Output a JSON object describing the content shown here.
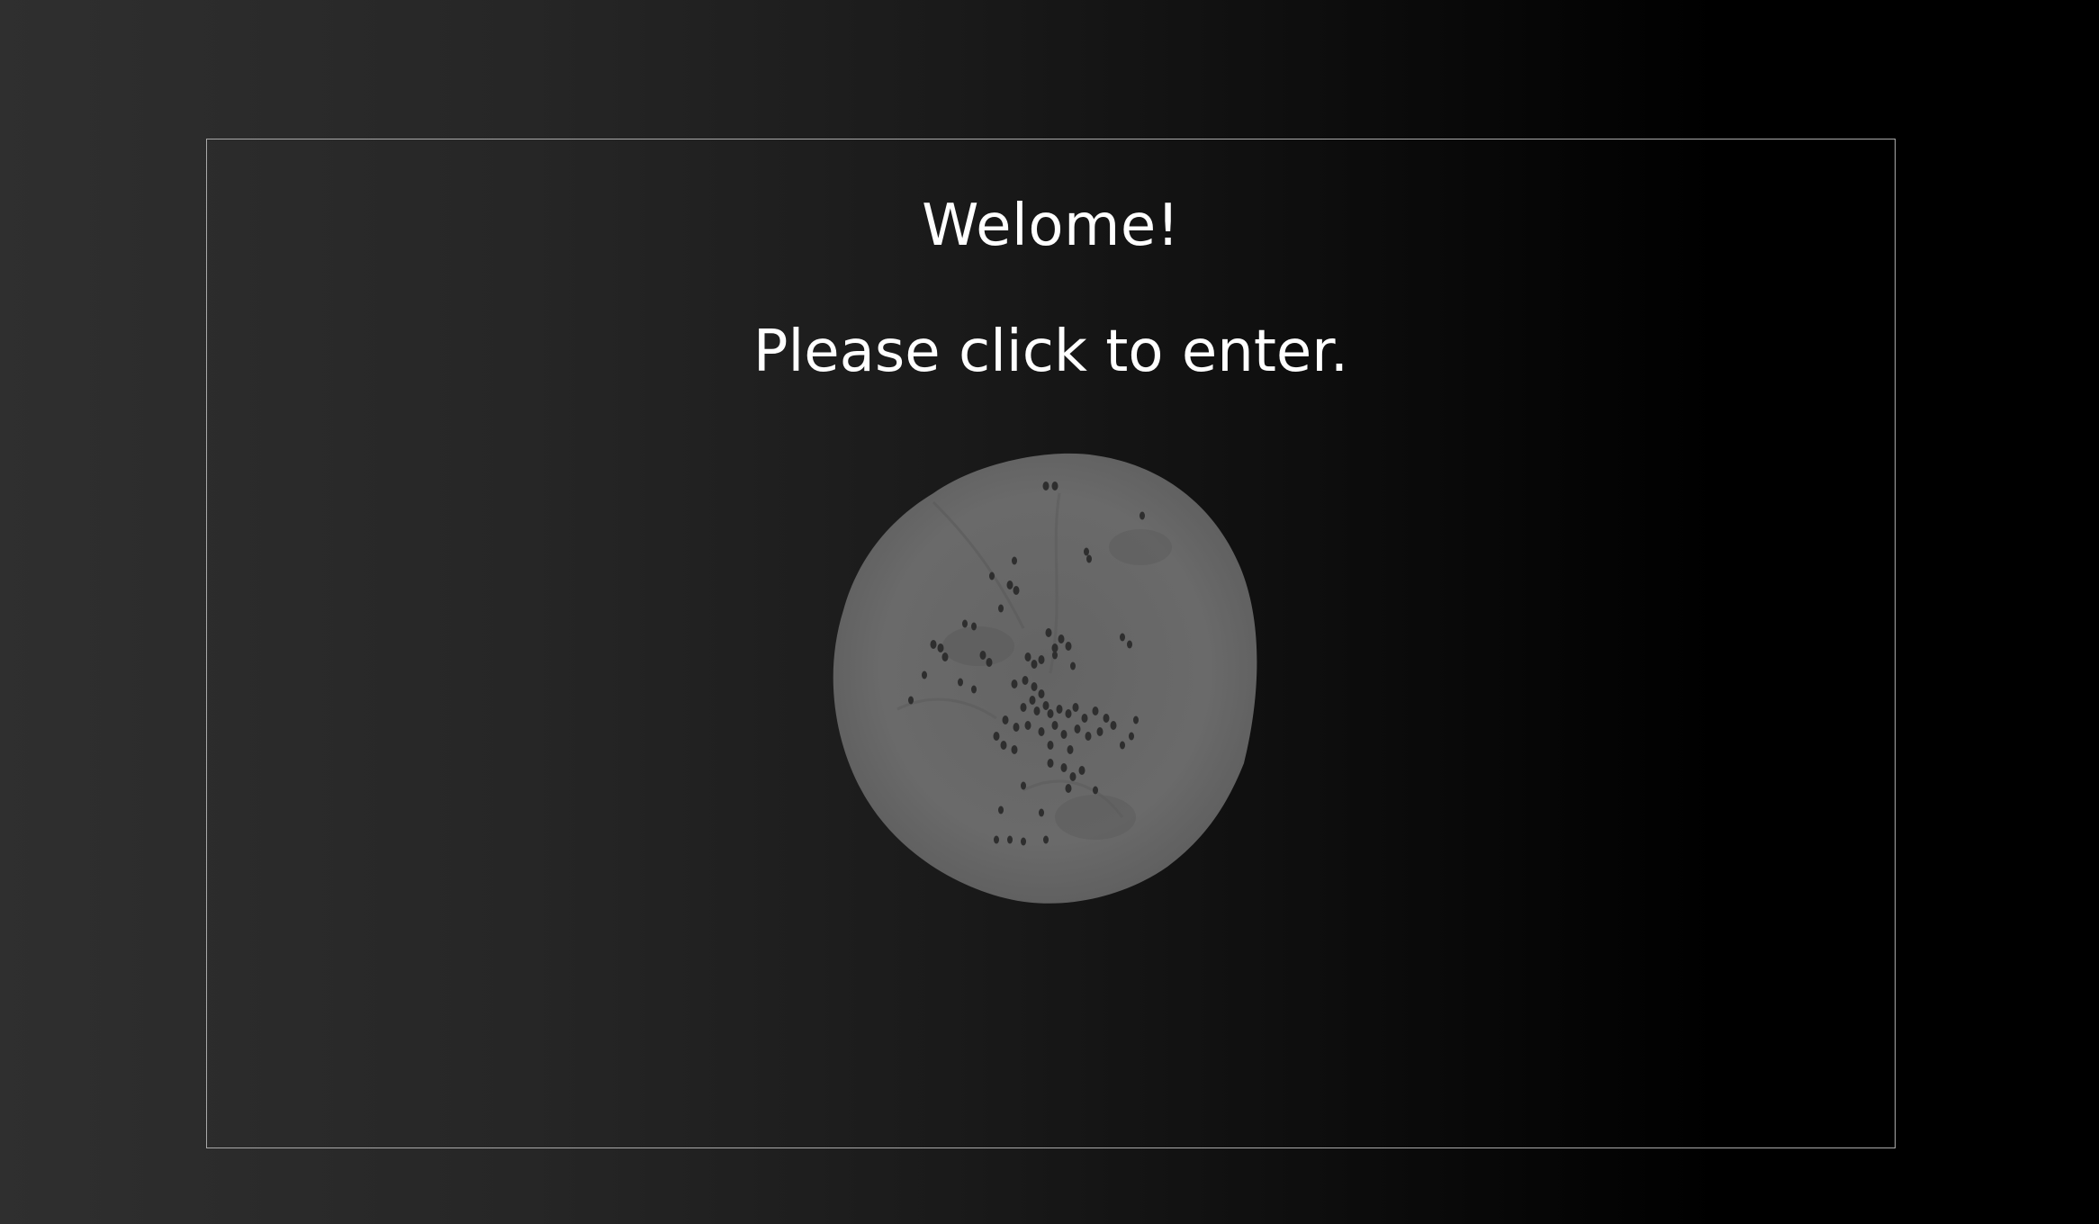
{
  "welcome": {
    "title": "Welome!",
    "subtitle": "Please click to enter."
  },
  "image": {
    "icon": "flatbread-image"
  },
  "colors": {
    "background_left": "#2f2f2f",
    "background_right": "#000000",
    "frame_border": "#a9a9a9",
    "text": "#ffffff",
    "bread_fill": "#6b6b6b",
    "seed_fill": "#2e2e2e"
  }
}
